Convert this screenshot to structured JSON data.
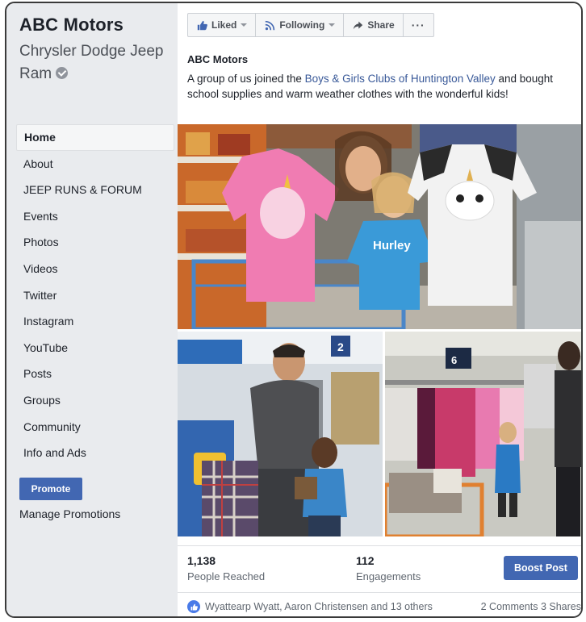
{
  "page": {
    "name": "ABC Motors",
    "subtitle": "Chrysler Dodge Jeep Ram"
  },
  "sidebar": {
    "items": [
      {
        "label": "Home",
        "active": true
      },
      {
        "label": "About"
      },
      {
        "label": "JEEP RUNS & FORUM"
      },
      {
        "label": "Events"
      },
      {
        "label": "Photos"
      },
      {
        "label": "Videos"
      },
      {
        "label": "Twitter"
      },
      {
        "label": "Instagram"
      },
      {
        "label": "YouTube"
      },
      {
        "label": "Posts"
      },
      {
        "label": "Groups"
      },
      {
        "label": "Community"
      },
      {
        "label": "Info and Ads"
      }
    ],
    "promote_label": "Promote",
    "manage_promotions_label": "Manage Promotions"
  },
  "actions": {
    "liked_label": "Liked",
    "following_label": "Following",
    "share_label": "Share",
    "more_label": "···"
  },
  "post": {
    "author": "ABC Motors",
    "text_before": "A group of us joined the ",
    "link_text": "Boys & Girls Clubs of Huntington Valley",
    "text_after": " and bought school supplies and warm weather clothes with the wonderful kids!"
  },
  "stats": {
    "reached_value": "1,138",
    "reached_label": "People Reached",
    "engagements_value": "112",
    "engagements_label": "Engagements",
    "boost_label": "Boost Post"
  },
  "reactions": {
    "reactors": "Wyattearp Wyatt, Aaron Christensen and 13 others",
    "comments": "2 Comments",
    "shares": "3 Shares"
  },
  "photo_text": {
    "shirt_brand": "Hurley",
    "aisle_number": "2",
    "price": "6"
  },
  "colors": {
    "accent": "#4267b2",
    "link": "#385898",
    "sidebar_bg": "#e9ebee"
  }
}
